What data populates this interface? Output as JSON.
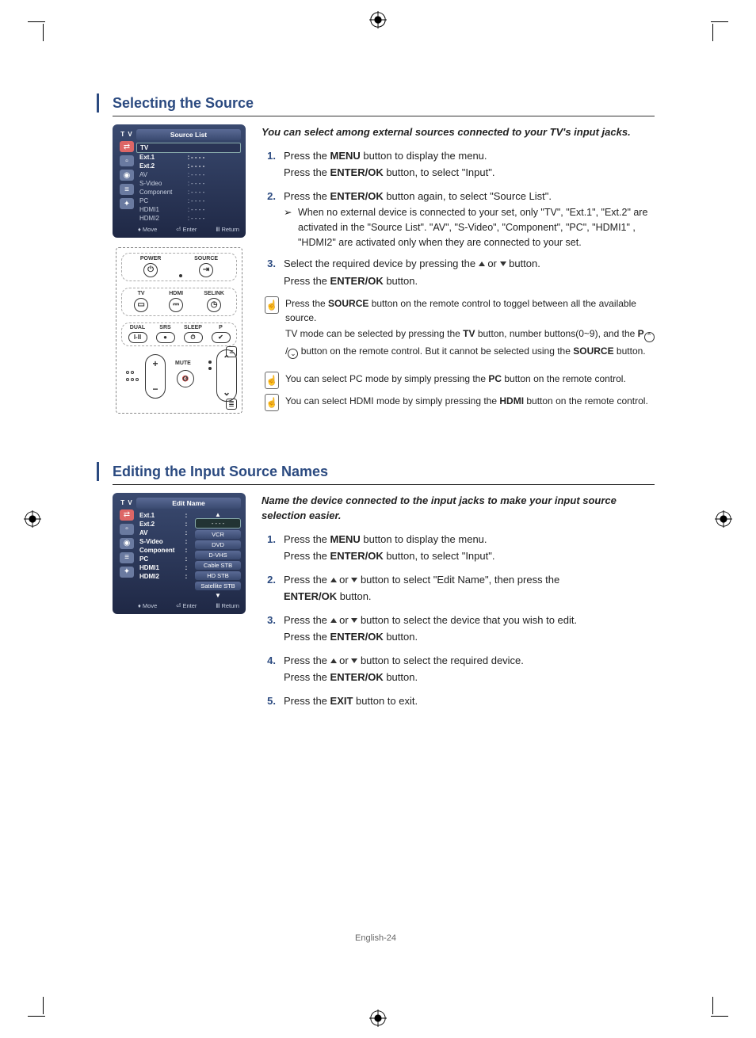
{
  "page_footer": "English-24",
  "sections": {
    "source": {
      "heading": "Selecting the Source",
      "intro": "You can select among external sources connected to your TV's input jacks.",
      "osd": {
        "nav_label": "T V",
        "title": "Source List",
        "items": [
          {
            "k": "TV",
            "v": "",
            "active": true
          },
          {
            "k": "Ext.1",
            "v": "- - - -",
            "bold": true
          },
          {
            "k": "Ext.2",
            "v": "- - - -",
            "bold": true
          },
          {
            "k": "AV",
            "v": "- - - -"
          },
          {
            "k": "S-Video",
            "v": "- - - -"
          },
          {
            "k": "Component",
            "v": "- - - -"
          },
          {
            "k": "PC",
            "v": "- - - -"
          },
          {
            "k": "HDMI1",
            "v": "- - - -"
          },
          {
            "k": "HDMI2",
            "v": "- - - -"
          }
        ],
        "footer": {
          "move": "Move",
          "enter": "Enter",
          "ret": "Return"
        }
      },
      "remote": {
        "power": "POWER",
        "sourcebtn": "SOURCE",
        "tv": "TV",
        "hdmi": "HDMI",
        "selink": "SELINK",
        "dual": "DUAL",
        "srs": "SRS",
        "sleep": "SLEEP",
        "p": "P",
        "dualglyph": "I-II",
        "mute": "MUTE"
      },
      "steps": {
        "s1a": "Press the ",
        "s1b": "MENU",
        "s1c": " button to display the menu.",
        "s1d": "Press the ",
        "s1e": "ENTER/OK",
        "s1f": " button, to select \"Input\".",
        "s2a": "Press the ",
        "s2b": "ENTER/OK",
        "s2c": " button again, to select \"Source List\".",
        "s2sub": "When no external device is connected to your set, only \"TV\", \"Ext.1\", \"Ext.2\" are activated in the \"Source List\". \"AV\", \"S-Video\", \"Component\", \"PC\", \"HDMI1\" , \"HDMI2\" are activated only when they are connected to your set.",
        "s3a": "Select the required device by pressing the ",
        "s3b": " or ",
        "s3c": " button.",
        "s3d": "Press the ",
        "s3e": "ENTER/OK",
        "s3f": " button."
      },
      "notes": {
        "n1a": "Press the ",
        "n1b": "SOURCE",
        "n1c": " button on the remote control to toggel between all the available source.",
        "n1d": "TV mode can be selected by pressing the ",
        "n1e": "TV",
        "n1f": " button, number buttons(0~9), and the ",
        "n1g": "P",
        "n1h": "button on the remote control. But it cannot be selected using the ",
        "n1i": "SOURCE",
        "n1j": " button.",
        "n2a": "You can select PC mode by simply pressing the ",
        "n2b": "PC",
        "n2c": " button on the remote control.",
        "n3a": "You can select HDMI mode by simply pressing the ",
        "n3b": "HDMI",
        "n3c": " button on the remote control."
      }
    },
    "edit": {
      "heading": "Editing the Input Source Names",
      "intro": "Name the device connected to the input jacks to make your input source selection easier.",
      "osd": {
        "nav_label": "T V",
        "title": "Edit Name",
        "items": [
          {
            "k": "Ext.1",
            "v": "- - - -",
            "bold": true,
            "vactive": true
          },
          {
            "k": "Ext.2",
            "v": "VCR",
            "bold": true,
            "vbtn": true
          },
          {
            "k": "AV",
            "v": "DVD",
            "bold": true,
            "vbtn": true
          },
          {
            "k": "S-Video",
            "v": "D-VHS",
            "bold": true,
            "vbtn": true
          },
          {
            "k": "Component",
            "v": "Cable STB",
            "bold": true,
            "vbtn": true
          },
          {
            "k": "PC",
            "v": "HD STB",
            "bold": true,
            "vbtn": true
          },
          {
            "k": "HDMI1",
            "v": "Satellite STB",
            "bold": true,
            "vbtn": true
          },
          {
            "k": "HDMI2",
            "v": "",
            "bold": true
          }
        ],
        "footer": {
          "move": "Move",
          "enter": "Enter",
          "ret": "Return"
        }
      },
      "steps": {
        "s1a": "Press the ",
        "s1b": "MENU",
        "s1c": " button to display the menu.",
        "s1d": "Press the ",
        "s1e": "ENTER/OK",
        "s1f": " button, to select \"Input\".",
        "s2a": "Press the ",
        "s2b": " or ",
        "s2c": " button to select \"Edit Name\", then press the ",
        "s2d": "ENTER/OK",
        "s2e": " button.",
        "s3a": "Press the ",
        "s3b": " or ",
        "s3c": " button to select the device that you wish to edit.",
        "s3d": "Press the ",
        "s3e": "ENTER/OK",
        "s3f": "  button.",
        "s4a": "Press the ",
        "s4b": " or ",
        "s4c": " button to select the required device.",
        "s4d": "Press the ",
        "s4e": "ENTER/OK",
        "s4f": " button.",
        "s5a": "Press the ",
        "s5b": "EXIT",
        "s5c": " button to exit."
      }
    }
  }
}
